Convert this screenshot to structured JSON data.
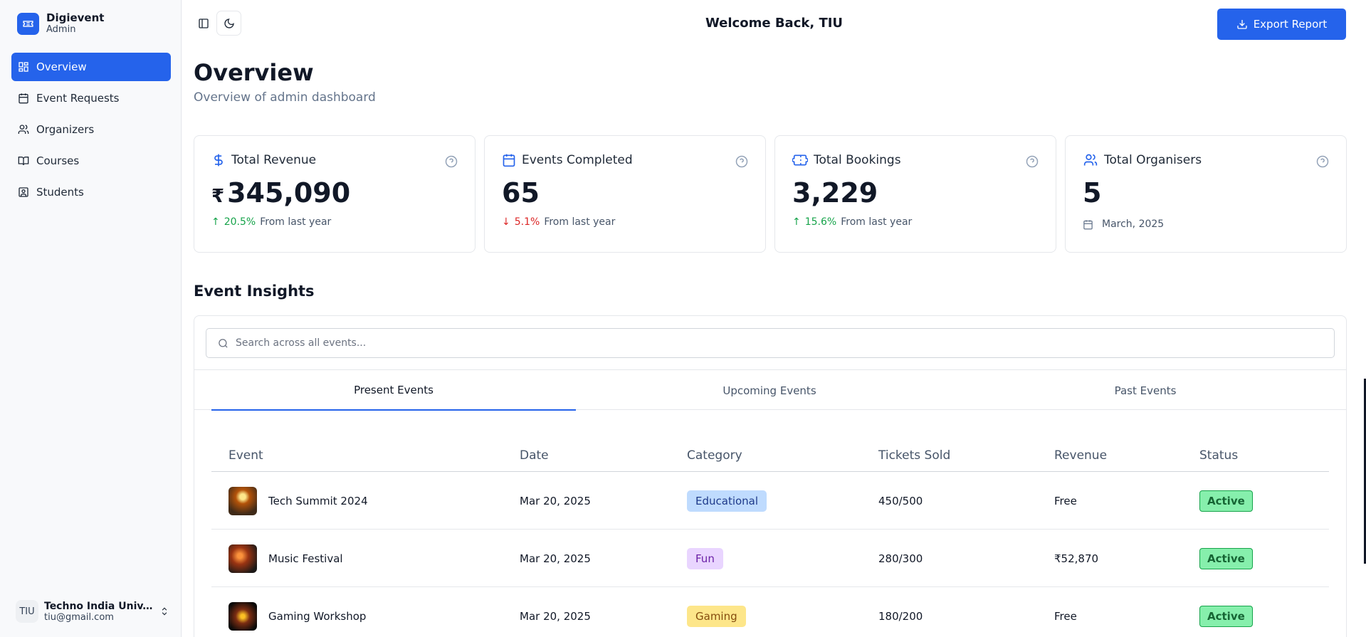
{
  "brand": {
    "name": "Digievent",
    "role": "Admin"
  },
  "nav": [
    {
      "label": "Overview",
      "icon": "dashboard-icon",
      "active": true
    },
    {
      "label": "Event Requests",
      "icon": "calendar-icon"
    },
    {
      "label": "Organizers",
      "icon": "users-icon"
    },
    {
      "label": "Courses",
      "icon": "book-icon"
    },
    {
      "label": "Students",
      "icon": "student-id-icon"
    }
  ],
  "user": {
    "avatar": "TIU",
    "name": "Techno India Univ...",
    "email": "tiu@gmail.com"
  },
  "header": {
    "welcome": "Welcome Back, TIU",
    "export_label": "Export Report"
  },
  "page": {
    "title": "Overview",
    "subtitle": "Overview of admin dashboard"
  },
  "cards": [
    {
      "title": "Total Revenue",
      "icon": "rupee-icon",
      "currency": "₹",
      "value": "345,090",
      "change": "20.5%",
      "trend": "up",
      "note": "From last year"
    },
    {
      "title": "Events Completed",
      "icon": "calendar-icon",
      "value": "65",
      "change": "5.1%",
      "trend": "down",
      "note": "From last year"
    },
    {
      "title": "Total Bookings",
      "icon": "ticket-icon",
      "value": "3,229",
      "change": "15.6%",
      "trend": "up",
      "note": "From last year"
    },
    {
      "title": "Total Organisers",
      "icon": "users-icon",
      "value": "5",
      "note": "March, 2025"
    }
  ],
  "insights": {
    "title": "Event Insights",
    "search_placeholder": "Search across all events...",
    "tabs": [
      "Present Events",
      "Upcoming Events",
      "Past Events"
    ],
    "active_tab": "Present Events",
    "columns": [
      "Event",
      "Date",
      "Category",
      "Tickets Sold",
      "Revenue",
      "Status"
    ],
    "rows": [
      {
        "event": "Tech Summit 2024",
        "date": "Mar 20, 2025",
        "category": "Educational",
        "category_color": "#bfdbfe",
        "category_text": "#1e3a8a",
        "tickets": "450/500",
        "revenue": "Free",
        "status": "Active"
      },
      {
        "event": "Music Festival",
        "date": "Mar 20, 2025",
        "category": "Fun",
        "category_color": "#e9d5ff",
        "category_text": "#6b21a8",
        "tickets": "280/300",
        "revenue": "₹52,870",
        "status": "Active"
      },
      {
        "event": "Gaming Workshop",
        "date": "Mar 20, 2025",
        "category": "Gaming",
        "category_color": "#fde68a",
        "category_text": "#854d0e",
        "tickets": "180/200",
        "revenue": "Free",
        "status": "Active"
      }
    ]
  },
  "colors": {
    "primary": "#2563eb",
    "positive": "#16a34a",
    "negative": "#dc2626"
  }
}
